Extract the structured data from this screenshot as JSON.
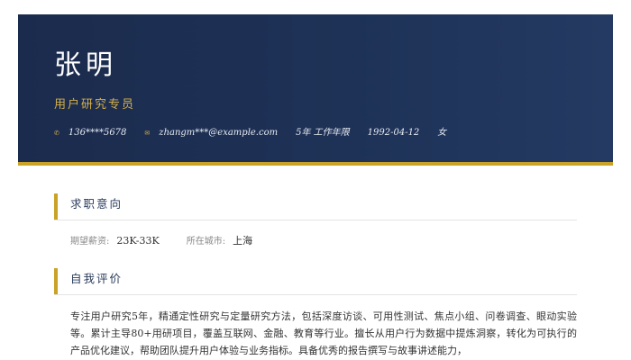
{
  "header": {
    "name": "张明",
    "job_title": "用户研究专员",
    "contacts": {
      "phone_icon": "phone-icon",
      "phone": "136****5678",
      "email_icon": "mail-icon",
      "email": "zhangm***@example.com",
      "experience": "5年 工作年限",
      "birthdate": "1992-04-12",
      "gender": "女"
    }
  },
  "sections": {
    "intention": {
      "title": "求职意向",
      "salary_label": "期望薪资:",
      "salary_value": "23K-33K",
      "city_label": "所在城市:",
      "city_value": "上海"
    },
    "self_evaluation": {
      "title": "自我评价",
      "text": "专注用户研究5年，精通定性研究与定量研究方法，包括深度访谈、可用性测试、焦点小组、问卷调查、眼动实验等。累计主导80+用研项目，覆盖互联网、金融、教育等行业。擅长从用户行为数据中提炼洞察，转化为可执行的产品优化建议，帮助团队提升用户体验与业务指标。具备优秀的报告撰写与故事讲述能力，"
    }
  },
  "colors": {
    "header_bg": "#1e3257",
    "accent_gold": "#c9a227",
    "section_title": "#2a3b5c"
  }
}
